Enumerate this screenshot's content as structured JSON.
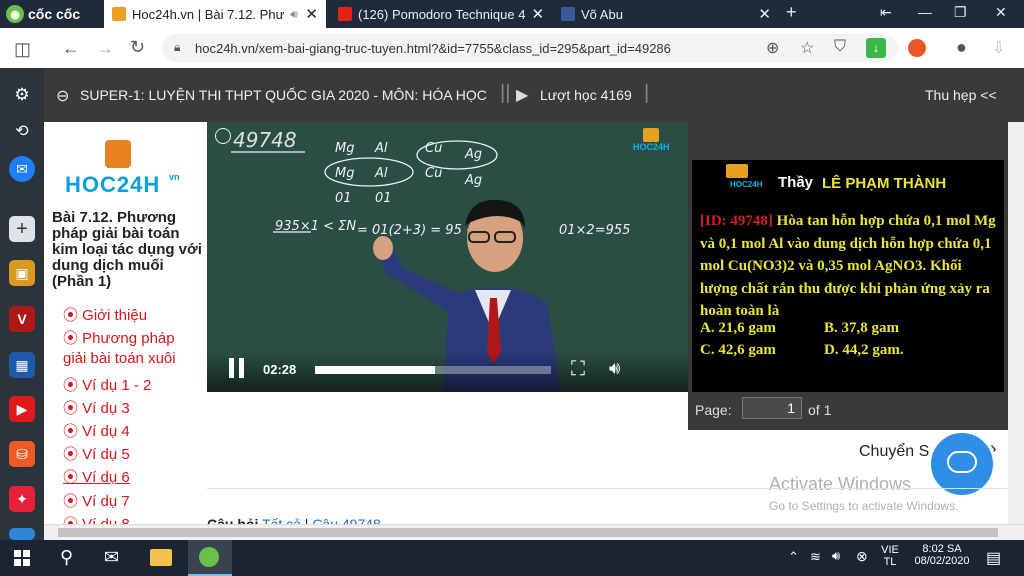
{
  "browser": {
    "brand": "cốc cốc",
    "tabs": [
      {
        "title": "Hoc24h.vn | Bài 7.12. Phư",
        "active": true
      },
      {
        "title": "(126) Pomodoro Technique 4",
        "active": false
      },
      {
        "title": "Võ Abu",
        "active": false
      }
    ],
    "new_tab": "+",
    "url": "hoc24h.vn/xem-bai-giang-truc-tuyen.html?&id=7755&class_id=295&part_id=49286"
  },
  "course": {
    "title": "SUPER-1: LUYỆN THI THPT QUỐC GIA 2020 - MÔN: HÓA HỌC",
    "views": "Lượt học 4169",
    "collapse": "Thu hẹp <<"
  },
  "sidebar": {
    "logo": "HOC24H",
    "logo_suffix": "vn",
    "lesson_title": "Bài 7.12. Phương pháp giải bài toán kim loại tác dụng với dung dịch muối (Phần 1)",
    "links": [
      {
        "label": "Giới thiệu",
        "active": false
      },
      {
        "label": "Phương pháp",
        "active": false
      },
      {
        "label": "giải bài toán xuôi",
        "active": false,
        "cont": true
      },
      {
        "label": "Ví dụ 1 - 2",
        "active": false
      },
      {
        "label": "Ví dụ 3",
        "active": false
      },
      {
        "label": "Ví dụ 4",
        "active": false
      },
      {
        "label": "Ví dụ 5",
        "active": false
      },
      {
        "label": "Ví dụ 6",
        "active": true
      },
      {
        "label": "Ví dụ 7",
        "active": false
      },
      {
        "label": "Ví dụ 8",
        "active": false
      }
    ]
  },
  "video": {
    "board_id": "49748",
    "time": "02:28",
    "progress": 0.51,
    "watermark": "HOC24H"
  },
  "question": {
    "teacher_prefix": "Thầy",
    "teacher_name": "LÊ PHẠM THÀNH",
    "id_label": "[ID: 49748]",
    "text": "Hòa tan hỗn hợp chứa 0,1 mol Mg và 0,1 mol Al vào dung dịch hỗn hợp chứa 0,1 mol Cu(NO3)2 và 0,35 mol AgNO3. Khối lượng chất rắn thu được khi phản ứng xảy ra hoàn toàn là",
    "options": [
      {
        "key": "A.",
        "value": "21,6 gam"
      },
      {
        "key": "B.",
        "value": "37,8 gam"
      },
      {
        "key": "C.",
        "value": "42,6 gam"
      },
      {
        "key": "D.",
        "value": "44,2 gam."
      }
    ],
    "page_label": "Page:",
    "page_value": "1",
    "page_of": "of 1"
  },
  "content": {
    "switch_label": "Chuyển S",
    "activate_title": "Activate Windows",
    "activate_sub": "Go to Settings to activate Windows.",
    "bottom_label": "Câu hỏi",
    "bottom_all": "Tất cả",
    "bottom_sep": "|",
    "bottom_id": "Câu 49748"
  },
  "taskbar": {
    "lang_line1": "VIE",
    "lang_line2": "TL",
    "time": "8:02 SA",
    "date": "08/02/2020"
  }
}
